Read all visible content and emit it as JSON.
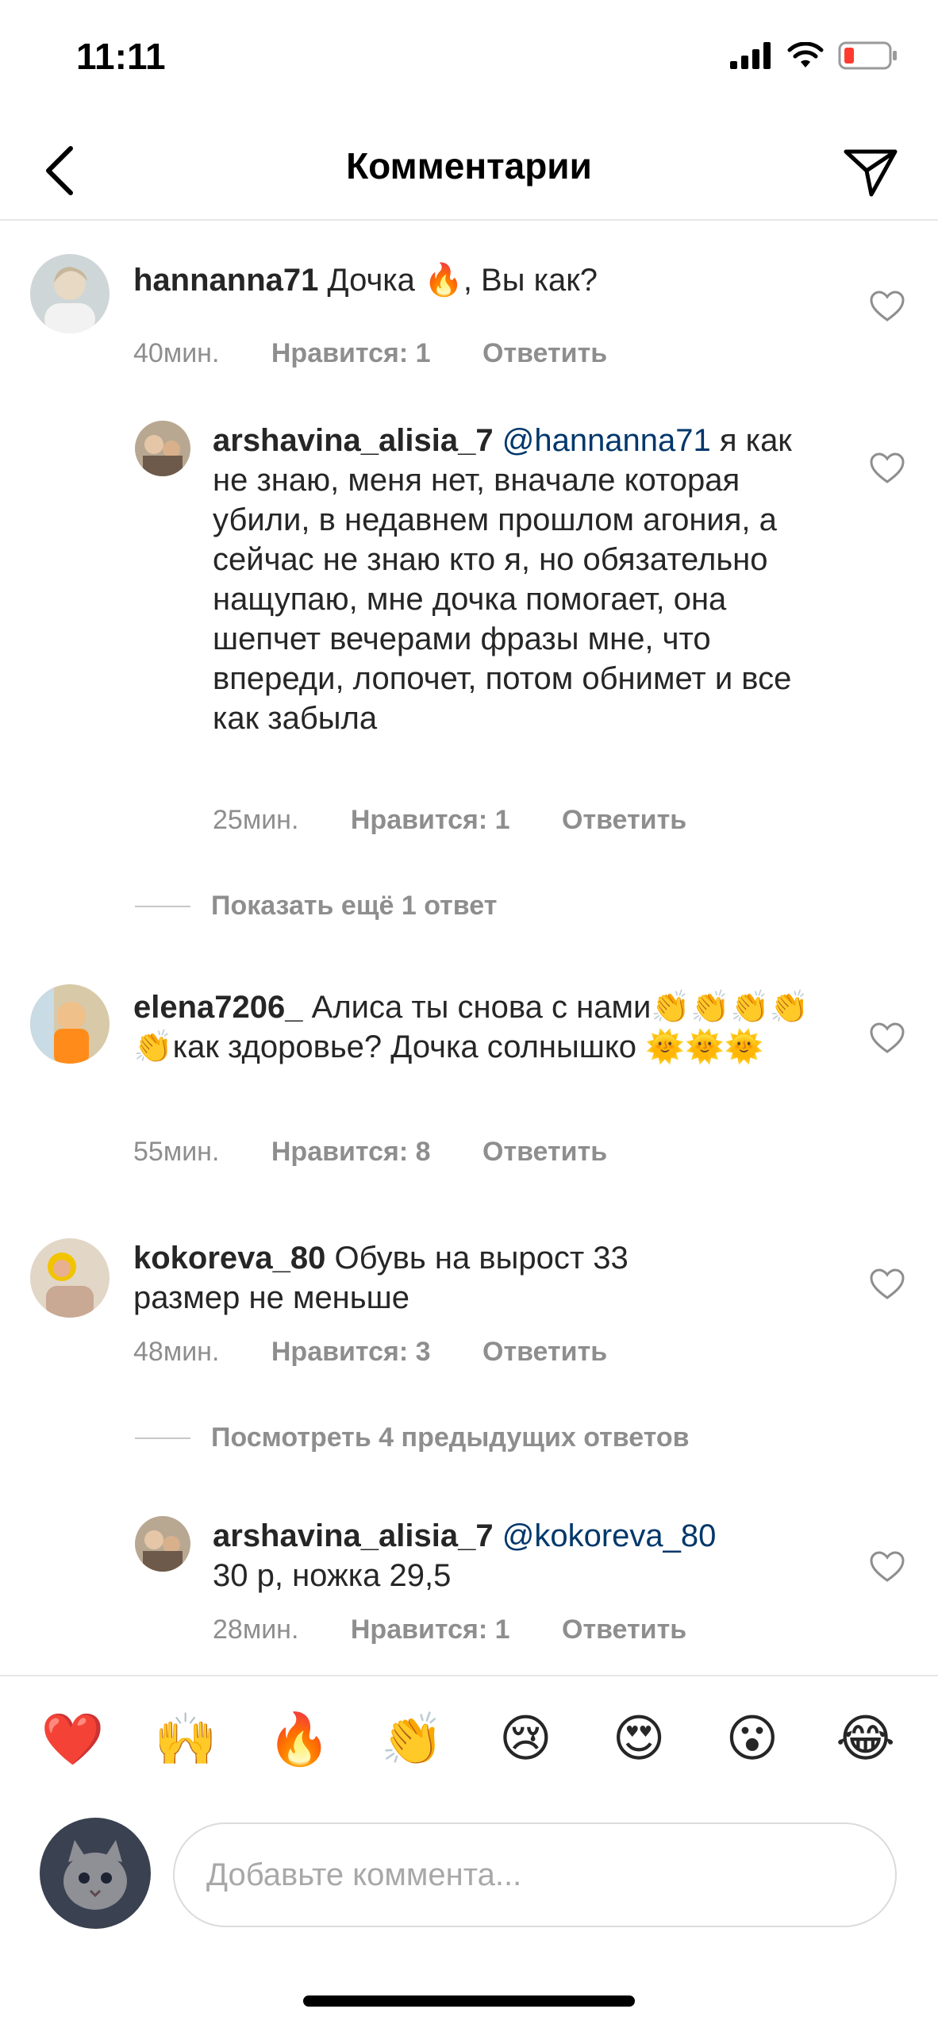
{
  "status": {
    "time": "11:11"
  },
  "header": {
    "title": "Комментарии"
  },
  "comments": [
    {
      "username": "hannanna71",
      "text": "Дочка 🔥, Вы как?",
      "time": "40мин.",
      "likes": "Нравится: 1",
      "reply": "Ответить"
    },
    {
      "username": "arshavina_alisia_7",
      "mention": "@hannanna71",
      "text": " я как не знаю, меня нет, вначале которая убили, в недавнем прошлом агония, а сейчас не знаю кто я, но обязательно нащупаю, мне дочка помогает, она шепчет вечерами фразы мне, что впереди, лопочет, потом обнимет и все как забыла",
      "time": "25мин.",
      "likes": "Нравится: 1",
      "reply": "Ответить"
    },
    {
      "username": "elena7206_",
      "text": "Алиса ты снова с нами👏👏👏👏👏как здоровье? Дочка солнышко 🌞🌞🌞",
      "time": "55мин.",
      "likes": "Нравится: 8",
      "reply": "Ответить"
    },
    {
      "username": "kokoreva_80",
      "text": "Обувь на вырост 33 размер не меньше",
      "time": "48мин.",
      "likes": "Нравится: 3",
      "reply": "Ответить"
    },
    {
      "username": "arshavina_alisia_7",
      "mention": "@kokoreva_80",
      "text": "30 р, ножка 29,5",
      "time": "28мин.",
      "likes": "Нравится: 1",
      "reply": "Ответить"
    }
  ],
  "more_replies_1": "Показать ещё 1 ответ",
  "more_replies_2": "Посмотреть 4 предыдущих ответов",
  "emoji_bar": [
    "❤️",
    "🙌",
    "🔥",
    "👏",
    "😢",
    "😍",
    "😮",
    "😂"
  ],
  "input": {
    "placeholder": "Добавьте коммента..."
  },
  "colors": {
    "text": "#262626",
    "secondary": "#8e8e8e",
    "mention": "#00376b",
    "battery_low": "#ff3b30"
  }
}
